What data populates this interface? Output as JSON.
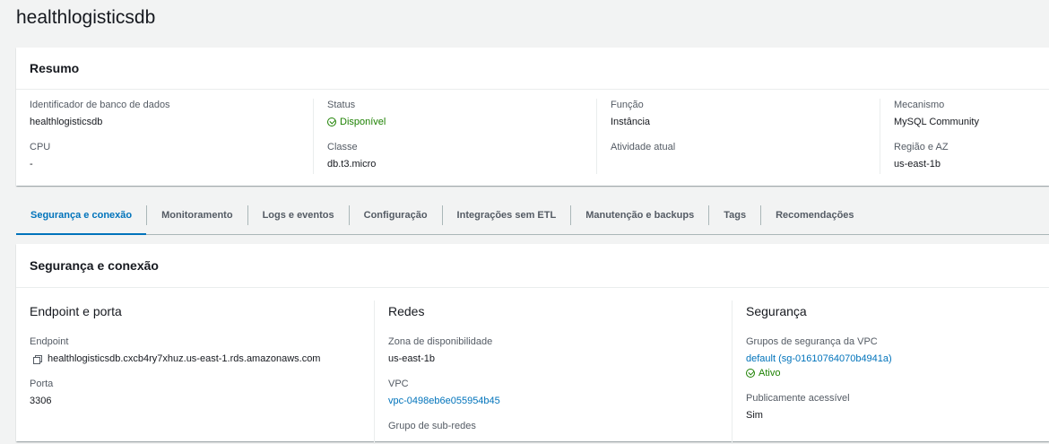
{
  "page": {
    "title": "healthlogisticsdb"
  },
  "summary": {
    "title": "Resumo",
    "columns": [
      {
        "items": [
          {
            "label": "Identificador de banco de dados",
            "value": "healthlogisticsdb"
          },
          {
            "label": "CPU",
            "value": "-"
          }
        ]
      },
      {
        "items": [
          {
            "label": "Status",
            "value": "Disponível",
            "icon": "check-circle-icon"
          },
          {
            "label": "Classe",
            "value": "db.t3.micro"
          }
        ]
      },
      {
        "items": [
          {
            "label": "Função",
            "value": "Instância"
          },
          {
            "label": "Atividade atual",
            "value": ""
          }
        ]
      },
      {
        "items": [
          {
            "label": "Mecanismo",
            "value": "MySQL Community"
          },
          {
            "label": "Região e AZ",
            "value": "us-east-1b"
          }
        ]
      }
    ]
  },
  "tabs": [
    {
      "label": "Segurança e conexão",
      "active": true
    },
    {
      "label": "Monitoramento"
    },
    {
      "label": "Logs e eventos"
    },
    {
      "label": "Configuração"
    },
    {
      "label": "Integrações sem ETL"
    },
    {
      "label": "Manutenção e backups"
    },
    {
      "label": "Tags"
    },
    {
      "label": "Recomendações"
    }
  ],
  "security": {
    "title": "Segurança e conexão",
    "endpoint": {
      "title": "Endpoint e porta",
      "endpoint_label": "Endpoint",
      "endpoint_value": "healthlogisticsdb.cxcb4ry7xhuz.us-east-1.rds.amazonaws.com",
      "port_label": "Porta",
      "port_value": "3306"
    },
    "networks": {
      "title": "Redes",
      "az_label": "Zona de disponibilidade",
      "az_value": "us-east-1b",
      "vpc_label": "VPC",
      "vpc_value": "vpc-0498eb6e055954b45",
      "subnet_label": "Grupo de sub-redes"
    },
    "security": {
      "title": "Segurança",
      "sg_label": "Grupos de segurança da VPC",
      "sg_value": "default (sg-01610764070b4941a)",
      "sg_status": "Ativo",
      "public_label": "Publicamente acessível",
      "public_value": "Sim"
    }
  },
  "colors": {
    "link": "#0073bb",
    "success": "#1d8102",
    "text": "#16191f",
    "muted": "#545b64"
  }
}
